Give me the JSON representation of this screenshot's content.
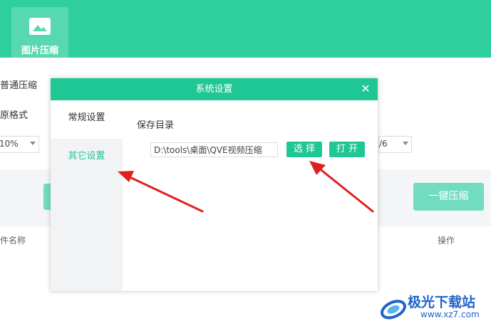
{
  "app": {
    "tab_label": "图片压缩",
    "tab_icon": "image-icon"
  },
  "background": {
    "row1_label": "普通压缩",
    "row2_label": "原格式",
    "quality_select": {
      "value": "10%"
    },
    "right_select": {
      "value": "/6"
    },
    "onekey_button": "一键压缩",
    "table_headers": {
      "left": "件名称",
      "right": "操作"
    }
  },
  "dialog": {
    "title": "系统设置",
    "close_icon": "close-icon",
    "sidebar": [
      {
        "label": "常规设置",
        "active": false
      },
      {
        "label": "其它设置",
        "active": true
      }
    ],
    "save_dir_label": "保存目录",
    "save_dir_value": "D:\\tools\\桌面\\QVE视频压缩",
    "choose_button": "选 择",
    "open_button": "打 开"
  },
  "watermark": {
    "name": "极光下载站",
    "url": "www.xz7.com"
  },
  "colors": {
    "topbar": "#2fcf9e",
    "accent": "#1fc795",
    "arrow": "#e02020"
  }
}
